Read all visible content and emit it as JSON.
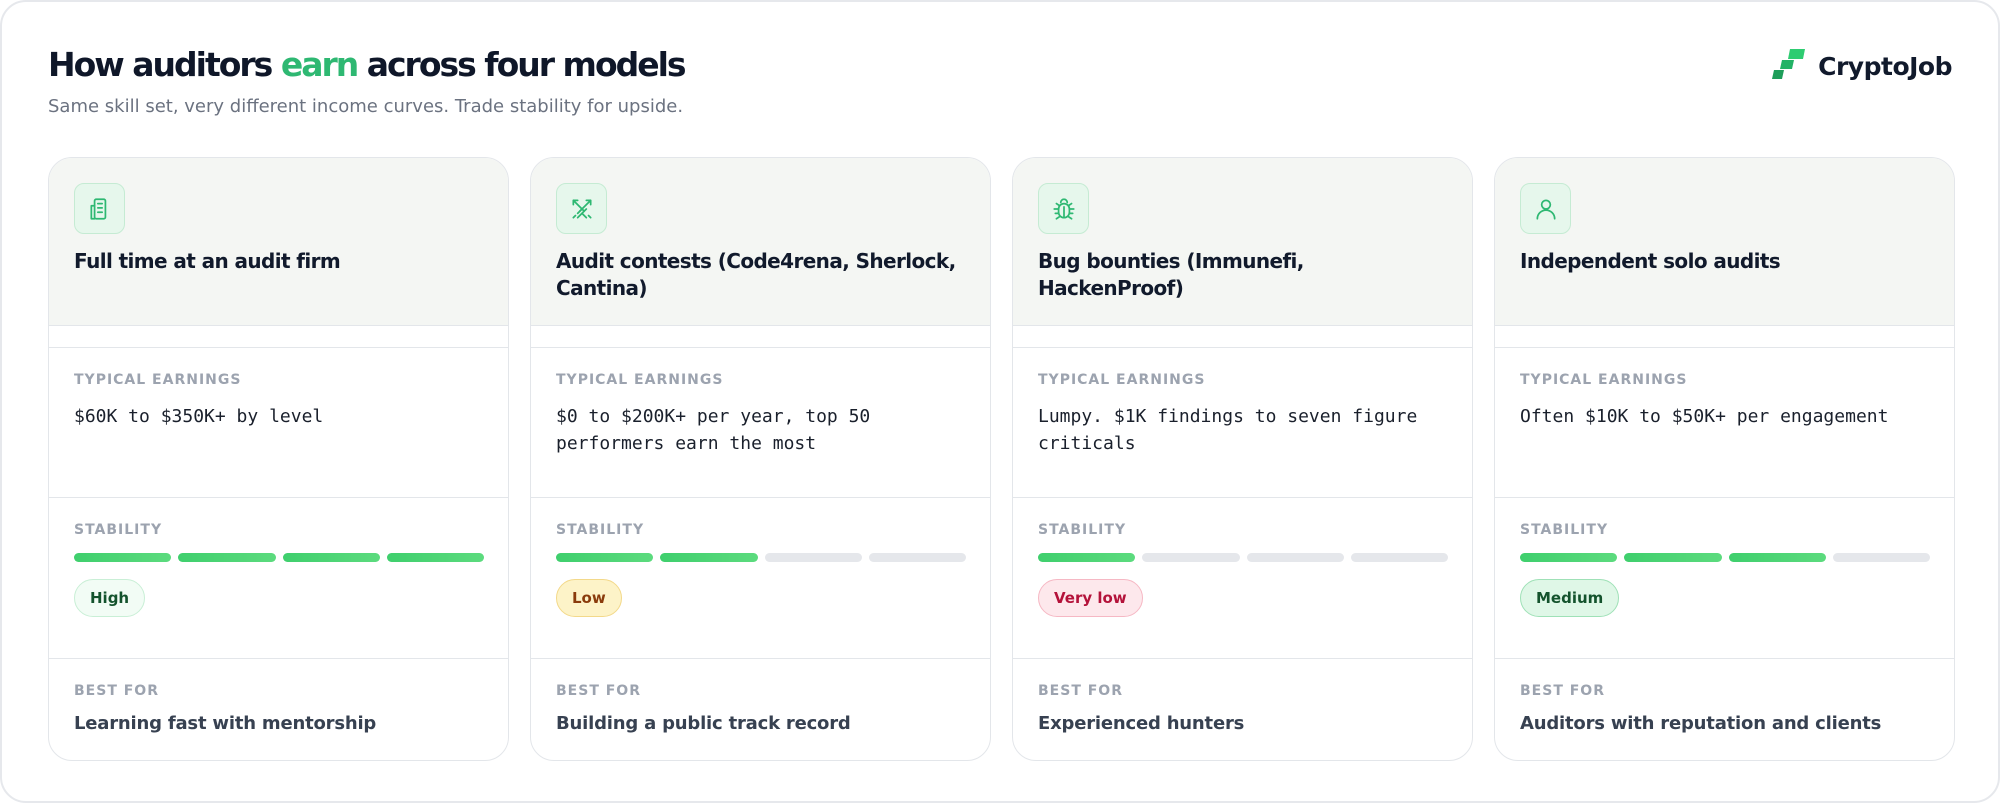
{
  "header": {
    "title_before": "How auditors ",
    "title_accent": "earn",
    "title_after": " across four models",
    "subtitle": "Same skill set, very different income curves. Trade stability for upside."
  },
  "brand": {
    "name": "CryptoJob",
    "icon": "cryptojob-logo-icon"
  },
  "labels": {
    "earnings": "TYPICAL EARNINGS",
    "stability": "STABILITY",
    "best_for": "BEST FOR"
  },
  "colors": {
    "accent": "#2eb872",
    "stability_on": "#4cd474",
    "stability_off": "#e5e7eb"
  },
  "cards": [
    {
      "icon": "building-icon",
      "title": "Full time at an audit firm",
      "earnings": "$60K to $350K+ by level",
      "stability_level": 4,
      "stability_max": 4,
      "badge": "High",
      "badge_colors": {
        "bg": "#f2fcf5",
        "border": "#c9efd6",
        "text": "#14532d"
      },
      "best_for": "Learning fast with mentorship"
    },
    {
      "icon": "crossed-swords-icon",
      "title": "Audit contests (Code4rena, Sherlock, Cantina)",
      "earnings": "$0 to $200K+ per year, top 50 performers earn the most",
      "stability_level": 2,
      "stability_max": 4,
      "badge": "Low",
      "badge_colors": {
        "bg": "#fdf3c8",
        "border": "#f3d98a",
        "text": "#8a3b0c"
      },
      "best_for": "Building a public track record"
    },
    {
      "icon": "bug-icon",
      "title": "Bug bounties (Immunefi, HackenProof)",
      "earnings": "Lumpy. $1K findings to seven figure criticals",
      "stability_level": 1,
      "stability_max": 4,
      "badge": "Very low",
      "badge_colors": {
        "bg": "#fde8ec",
        "border": "#f6b8c4",
        "text": "#b4123a"
      },
      "best_for": "Experienced hunters"
    },
    {
      "icon": "user-icon",
      "title": "Independent solo audits",
      "earnings": "Often $10K to $50K+ per engagement",
      "stability_level": 3,
      "stability_max": 4,
      "badge": "Medium",
      "badge_colors": {
        "bg": "#dff7e7",
        "border": "#9fe1b7",
        "text": "#14532d"
      },
      "best_for": "Auditors with reputation and clients"
    }
  ]
}
